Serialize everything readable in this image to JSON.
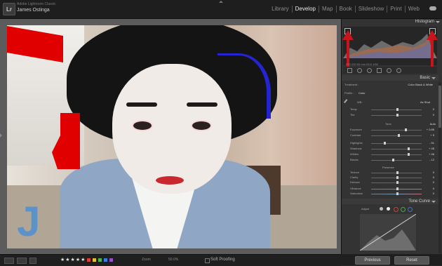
{
  "app": {
    "logo": "Lr",
    "product": "Adobe Lightroom Classic",
    "user": "James Ostinga"
  },
  "modules": [
    {
      "label": "Library",
      "active": false
    },
    {
      "label": "Develop",
      "active": true
    },
    {
      "label": "Map",
      "active": false
    },
    {
      "label": "Book",
      "active": false
    },
    {
      "label": "Slideshow",
      "active": false
    },
    {
      "label": "Print",
      "active": false
    },
    {
      "label": "Web",
      "active": false
    }
  ],
  "histogram": {
    "title": "Histogram",
    "meta1": "ISO 200    50 mm    f/5.6    1/80",
    "meta2": "Original + Smart Preview"
  },
  "basic": {
    "title": "Basic",
    "treatment_label": "Treatment :",
    "treatment_opts": "Color    Black & White",
    "profile_label": "Profile :",
    "profile_value": "Color",
    "wb_label": "WB :",
    "wb_value": "As Shot",
    "sliders_wb": [
      {
        "label": "Temp",
        "value": "0"
      },
      {
        "label": "Tint",
        "value": "0"
      }
    ],
    "tone_label": "Tone",
    "tone_auto": "Auto",
    "sliders_tone": [
      {
        "label": "Exposure",
        "value": "+ 0.85"
      },
      {
        "label": "Contrast",
        "value": "+ 5"
      },
      {
        "label": "Highlights",
        "value": "- 51"
      },
      {
        "label": "Shadows",
        "value": "+ 45"
      },
      {
        "label": "Whites",
        "value": "+ 46"
      },
      {
        "label": "Blacks",
        "value": "- 12"
      }
    ],
    "presence_label": "Presence",
    "sliders_presence": [
      {
        "label": "Texture",
        "value": "0"
      },
      {
        "label": "Clarity",
        "value": "0"
      },
      {
        "label": "Dehaze",
        "value": "0"
      },
      {
        "label": "Vibrance",
        "value": "0"
      },
      {
        "label": "Saturation",
        "value": "0"
      }
    ]
  },
  "tone_curve": {
    "title": "Tone Curve",
    "adjust_label": "Adjust"
  },
  "toolbar": {
    "stars": "★★★★★",
    "zoom_label": "Zoom",
    "zoom_value": "50.0%",
    "soft_proofing": "Soft Proofing"
  },
  "buttons": {
    "previous": "Previous",
    "reset": "Reset"
  },
  "colors": {
    "accent": "#c8141b",
    "clip_highlight": "#e00000",
    "clip_shadow": "#2424d0"
  }
}
